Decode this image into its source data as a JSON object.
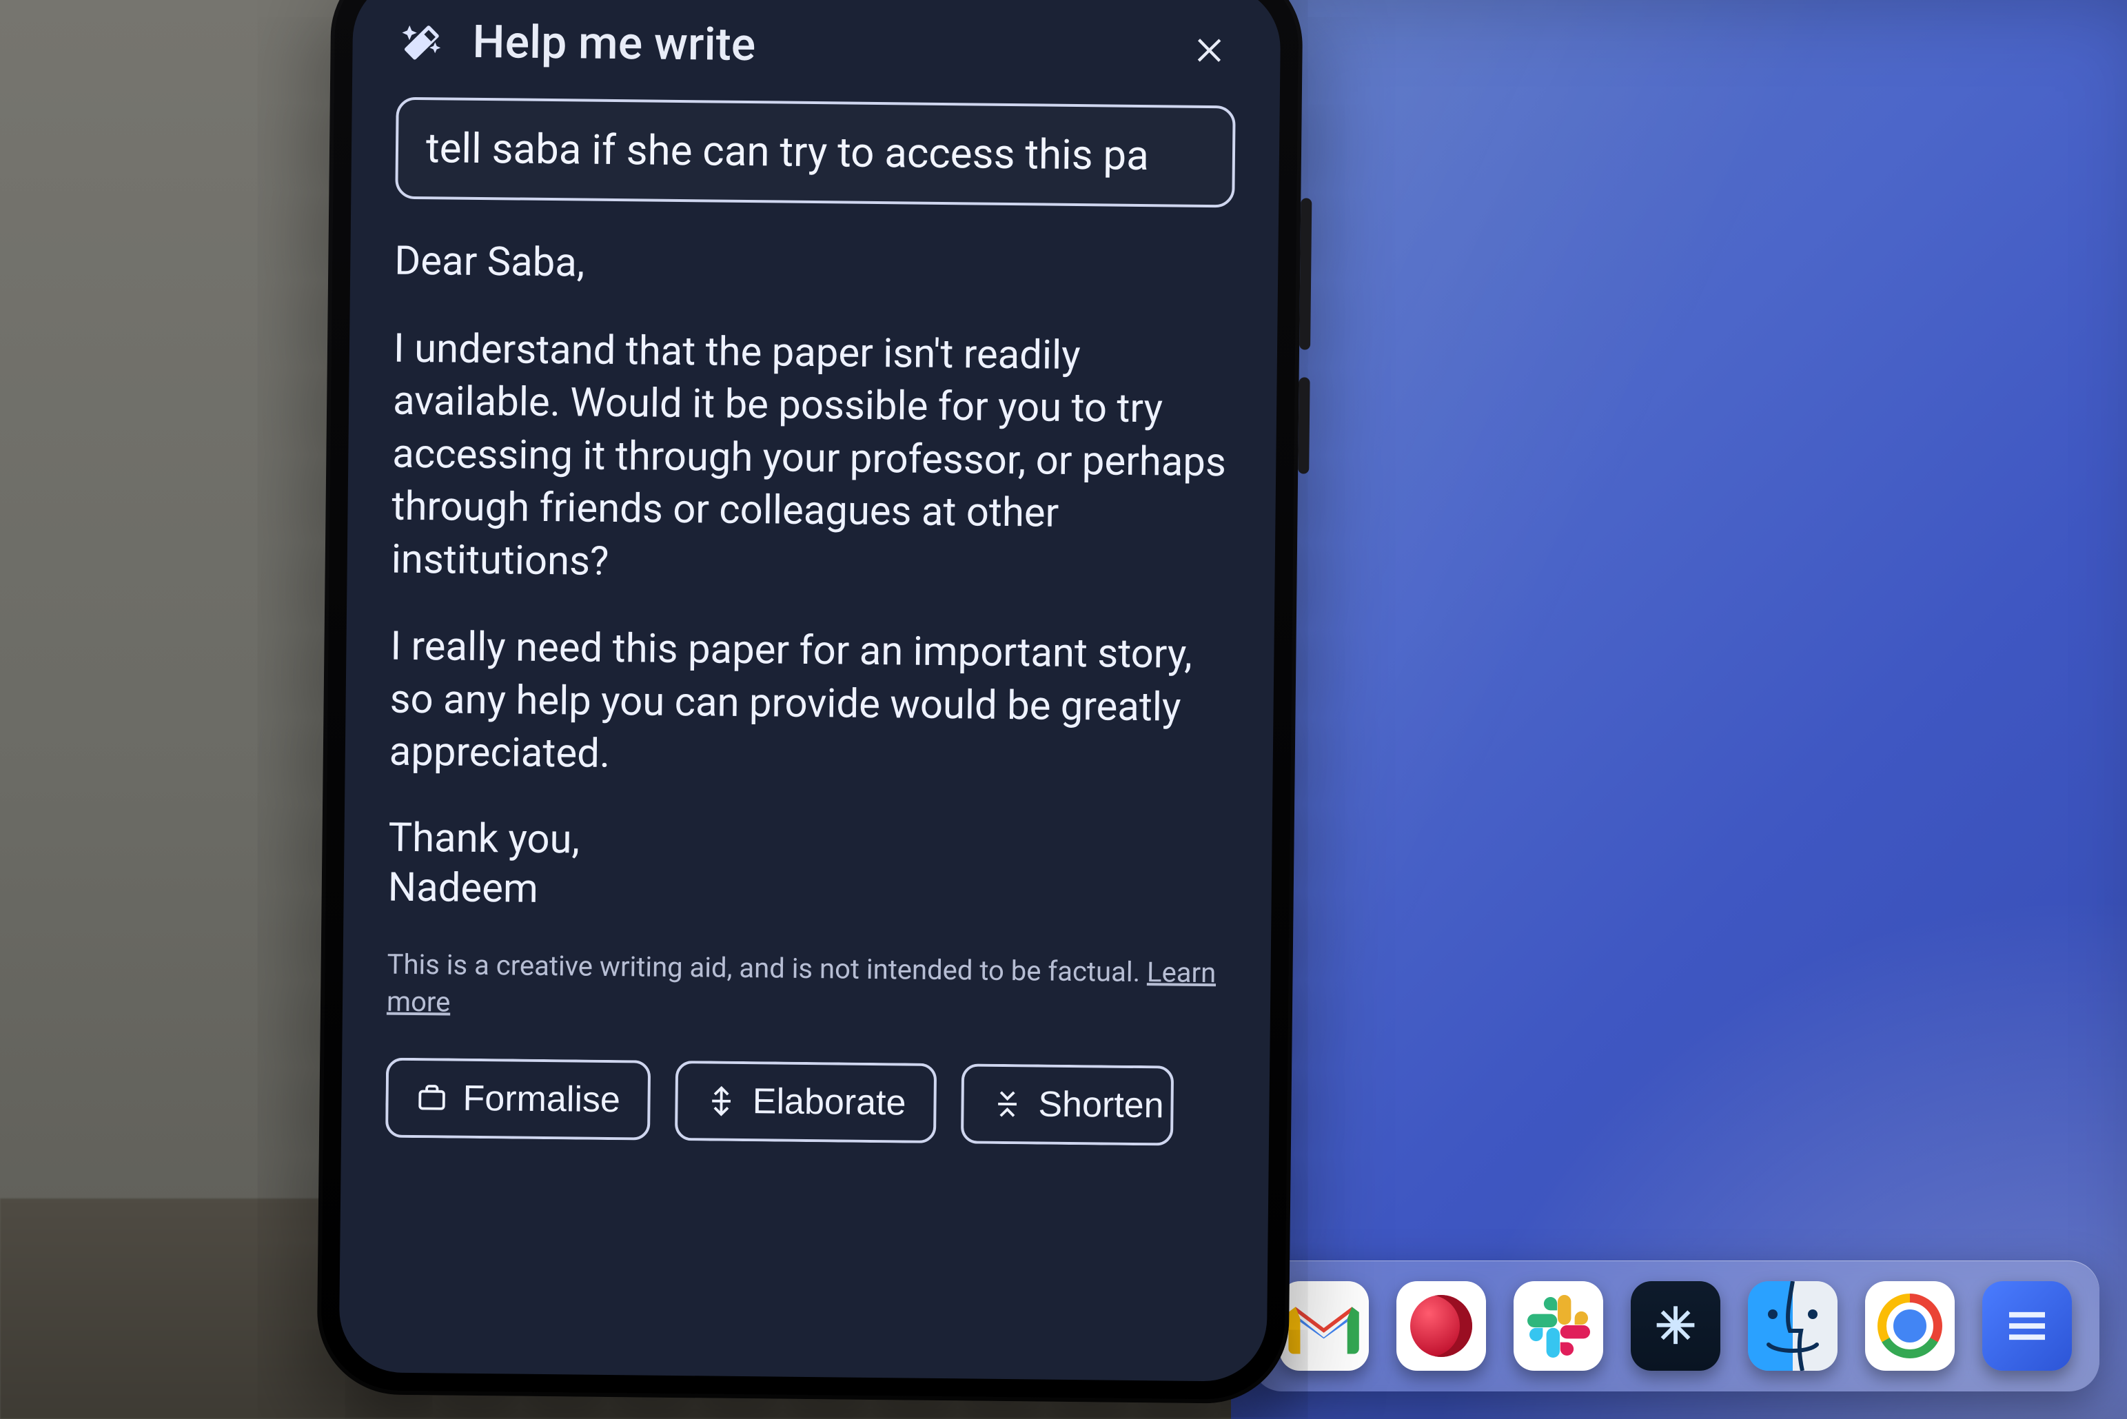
{
  "panel": {
    "title": "Help me write",
    "prompt_value": "tell saba if she can try to access this pa",
    "close_aria": "Close"
  },
  "draft": {
    "greeting": "Dear Saba,",
    "p1": "I understand that the paper isn't readily available. Would it be possible for you to try accessing it through your professor, or perhaps through friends or colleagues at other institutions?",
    "p2": "I really need this paper for an important story, so any help you can provide would be greatly appreciated.",
    "signoff_line1": "Thank you,",
    "signoff_line2": "Nadeem"
  },
  "disclaimer": {
    "text": "This is a creative writing aid, and is not intended to be factual. ",
    "learn_more": "Learn more"
  },
  "chips": {
    "formalise": "Formalise",
    "elaborate": "Elaborate",
    "shorten": "Shorten"
  },
  "dock": {
    "items": [
      "gmail",
      "opera",
      "slack",
      "asterisk",
      "finder",
      "chrome",
      "app"
    ]
  }
}
